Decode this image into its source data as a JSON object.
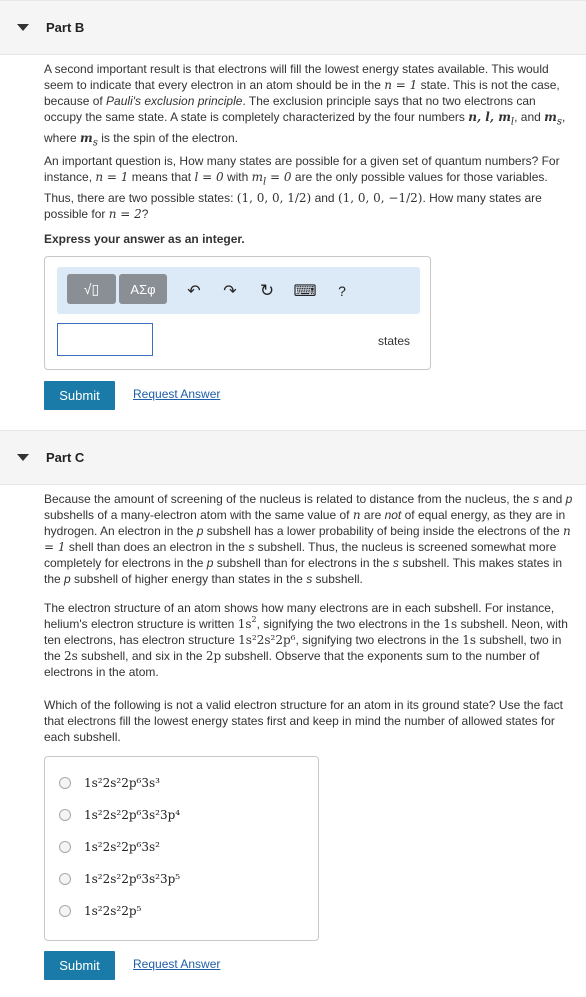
{
  "partB": {
    "title": "Part B",
    "p1_a": "A second important result is that electrons will fill the lowest energy states available. This would seem to indicate that every electron in an atom should be in the ",
    "p1_b": " state. This is not the case, because of ",
    "p1_c": "Pauli's exclusion principle",
    "p1_d": ". The exclusion principle says that no two electrons can occupy the same state. A state is completely characterized by the four numbers ",
    "p1_e": ", and ",
    "p1_f": ", where ",
    "p1_g": " is the spin of the electron.",
    "p2_a": "An important question is, How many states are possible for a given set of quantum numbers? For instance, ",
    "p2_b": " means that ",
    "p2_c": " with ",
    "p2_d": " are the only possible values for those variables. Thus, there are two possible states: ",
    "p2_e": " and ",
    "p2_f": ". How many states are possible for ",
    "p2_g": "?",
    "math": {
      "n1": "n = 1",
      "nlist": "n, l, m",
      "ml_sub": "l",
      "ms": "m",
      "ms_sub": "s",
      "l0": "l = 0",
      "ml0": "m",
      "ml0_rest": " = 0",
      "state1": "(1, 0, 0, 1/2)",
      "state2": "(1, 0, 0, −1/2)",
      "n2": "n = 2"
    },
    "instruction": "Express your answer as an integer.",
    "toolbar": {
      "templates": "√▯",
      "greek": "ΑΣφ",
      "undo": "↶",
      "redo": "↷",
      "reset": "↻",
      "keyboard": "⌨",
      "help": "?"
    },
    "answer_value": "",
    "unit": "states",
    "submit_label": "Submit",
    "request_label": "Request Answer"
  },
  "partC": {
    "title": "Part C",
    "p1_a": "Because the amount of screening of the nucleus is related to distance from the nucleus, the ",
    "p1_s1": "s",
    "p1_b": " and ",
    "p1_p1": "p",
    "p1_c": " subshells of a many-electron atom with the same value of ",
    "p1_n": "n",
    "p1_d": " are ",
    "p1_not": "not",
    "p1_e": " of equal energy, as they are in hydrogen. An electron in the ",
    "p1_p2": "p",
    "p1_f": " subshell has a lower probability of being inside the electrons of the ",
    "p1_n1": "n = 1",
    "p1_g": " shell than does an electron in the ",
    "p1_s2": "s",
    "p1_h": " subshell. Thus, the nucleus is screened somewhat more completely for electrons in the ",
    "p1_p3": "p",
    "p1_i": " subshell than for electrons in the ",
    "p1_s3": "s",
    "p1_j": " subshell. This makes states in the ",
    "p1_p4": "p",
    "p1_k": " subshell of higher energy than states in the ",
    "p1_s4": "s",
    "p1_l": " subshell.",
    "p2_a": "The electron structure of an atom shows how many electrons are in each subshell. For instance, helium's electron structure is written ",
    "p2_he": "1s",
    "p2_b": ", signifying the two electrons in the ",
    "p2_1s": "1s",
    "p2_c": " subshell. Neon, with ten electrons, has electron structure ",
    "p2_ne": "1s²2s²2p⁶",
    "p2_d": ", signifying two electrons in the ",
    "p2_1s_b": "1s",
    "p2_e": " subshell, two in the ",
    "p2_2s": "2s",
    "p2_f": " subshell, and six in the ",
    "p2_2p": "2p",
    "p2_g": " subshell. Observe that the exponents sum to the number of electrons in the atom.",
    "p3": "Which of the following is not a valid electron structure for an atom in its ground state? Use the fact that electrons fill the lowest energy states first and keep in mind the number of allowed states for each subshell.",
    "options": [
      "1s²2s²2p⁶3s³",
      "1s²2s²2p⁶3s²3p⁴",
      "1s²2s²2p⁶3s²",
      "1s²2s²2p⁶3s²3p⁵",
      "1s²2s²2p⁵"
    ],
    "submit_label": "Submit",
    "request_label": "Request Answer"
  },
  "colors": {
    "submit": "#1a7aa8",
    "link": "#1f5ea8",
    "toolbar": "#dce9f7",
    "input_border": "#3a6fc2"
  }
}
